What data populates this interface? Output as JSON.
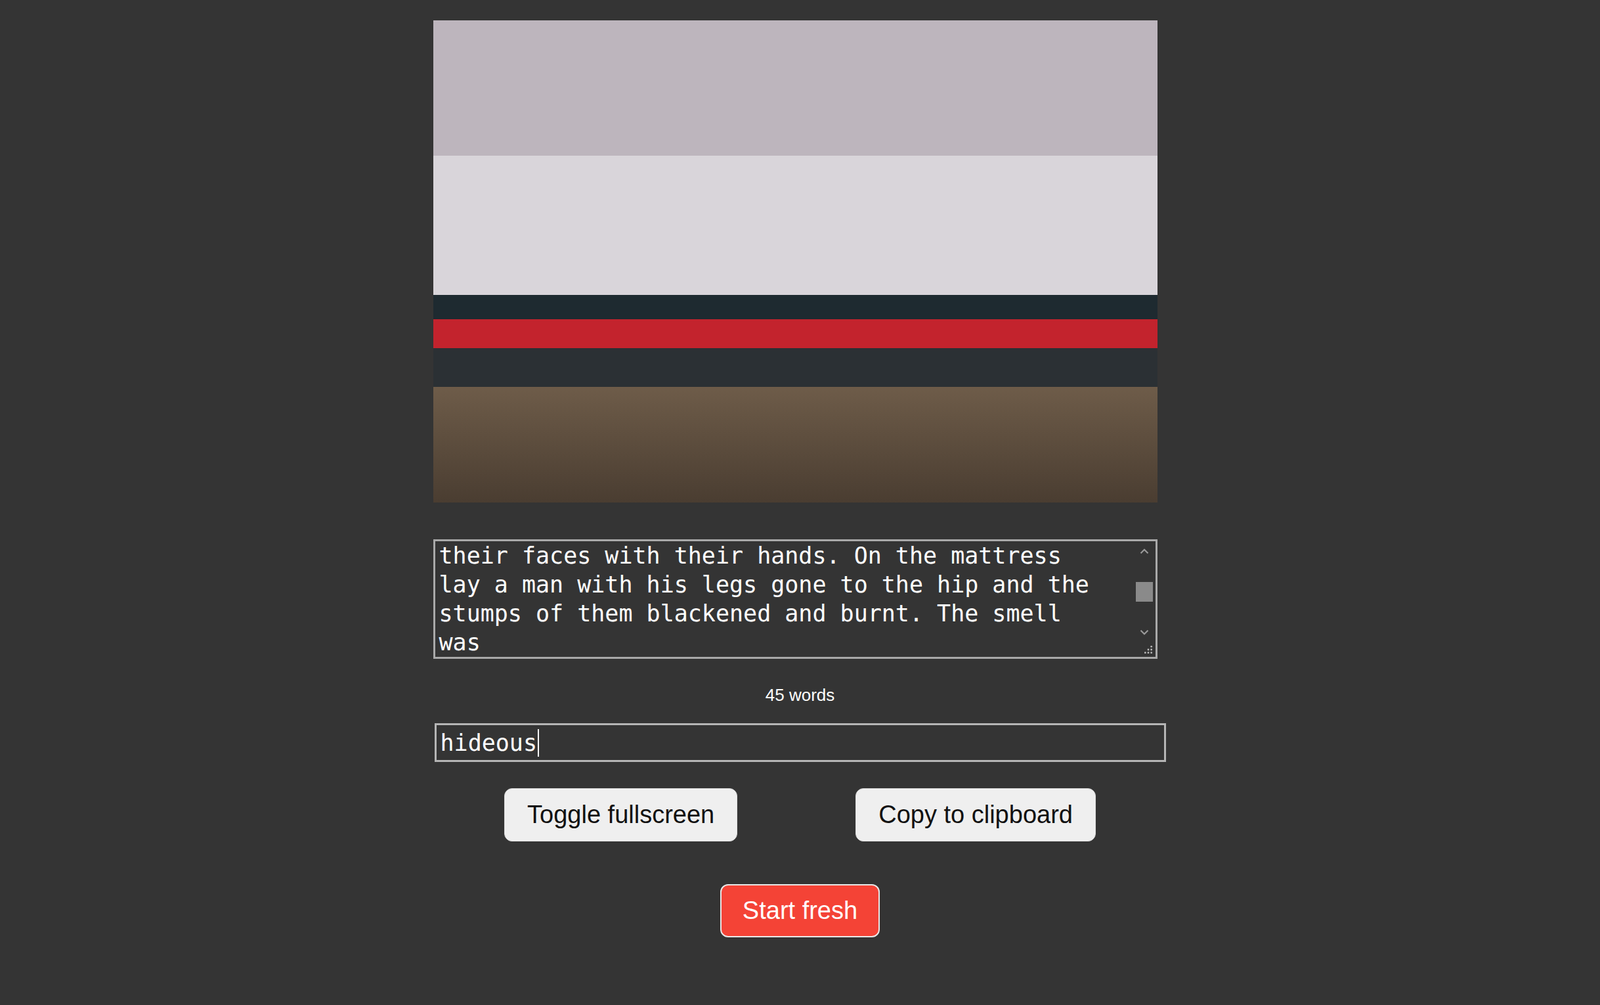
{
  "editor": {
    "lines": [
      "their faces with their hands. On the mattress",
      "lay a man with his legs gone to the hip and the",
      "stumps of them blackened and burnt. The smell",
      "was"
    ],
    "scrollbar": {
      "level": 0.5
    }
  },
  "word_count": "45 words",
  "input": {
    "value": "hideous",
    "focused": true
  },
  "buttons": [
    {
      "label": "Toggle fullscreen"
    },
    {
      "label": "Copy to clipboard"
    }
  ],
  "reset_button": {
    "label": "Start fresh"
  }
}
